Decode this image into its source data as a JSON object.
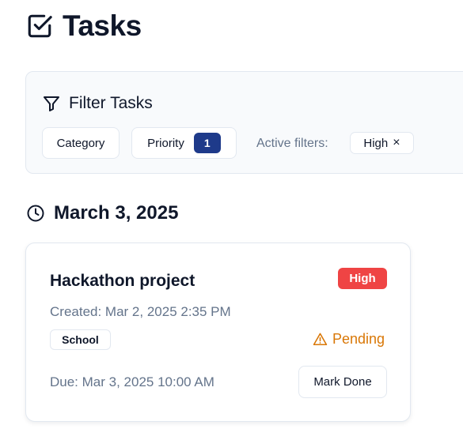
{
  "header": {
    "title": "Tasks",
    "icon": "square-check-icon"
  },
  "filters": {
    "title": "Filter Tasks",
    "icon": "filter-icon",
    "category_label": "Category",
    "priority_label": "Priority",
    "priority_count": "1",
    "active_label": "Active filters:",
    "active_chips": [
      {
        "label": "High",
        "remove": "×"
      }
    ]
  },
  "groups": [
    {
      "date": "March 3, 2025",
      "icon": "clock-icon",
      "tasks": [
        {
          "title": "Hackathon project",
          "priority": "High",
          "created": "Created: Mar 2, 2025 2:35 PM",
          "category": "School",
          "status": "Pending",
          "status_icon": "warning-triangle-icon",
          "due": "Due: Mar 3, 2025 10:00 AM",
          "action_label": "Mark Done"
        }
      ]
    }
  ],
  "colors": {
    "accent": "#1e3a8a",
    "high": "#ef4444",
    "pending": "#d97706",
    "muted": "#64748b",
    "border": "#e2e8f0",
    "panel_bg": "#f8fafc"
  }
}
